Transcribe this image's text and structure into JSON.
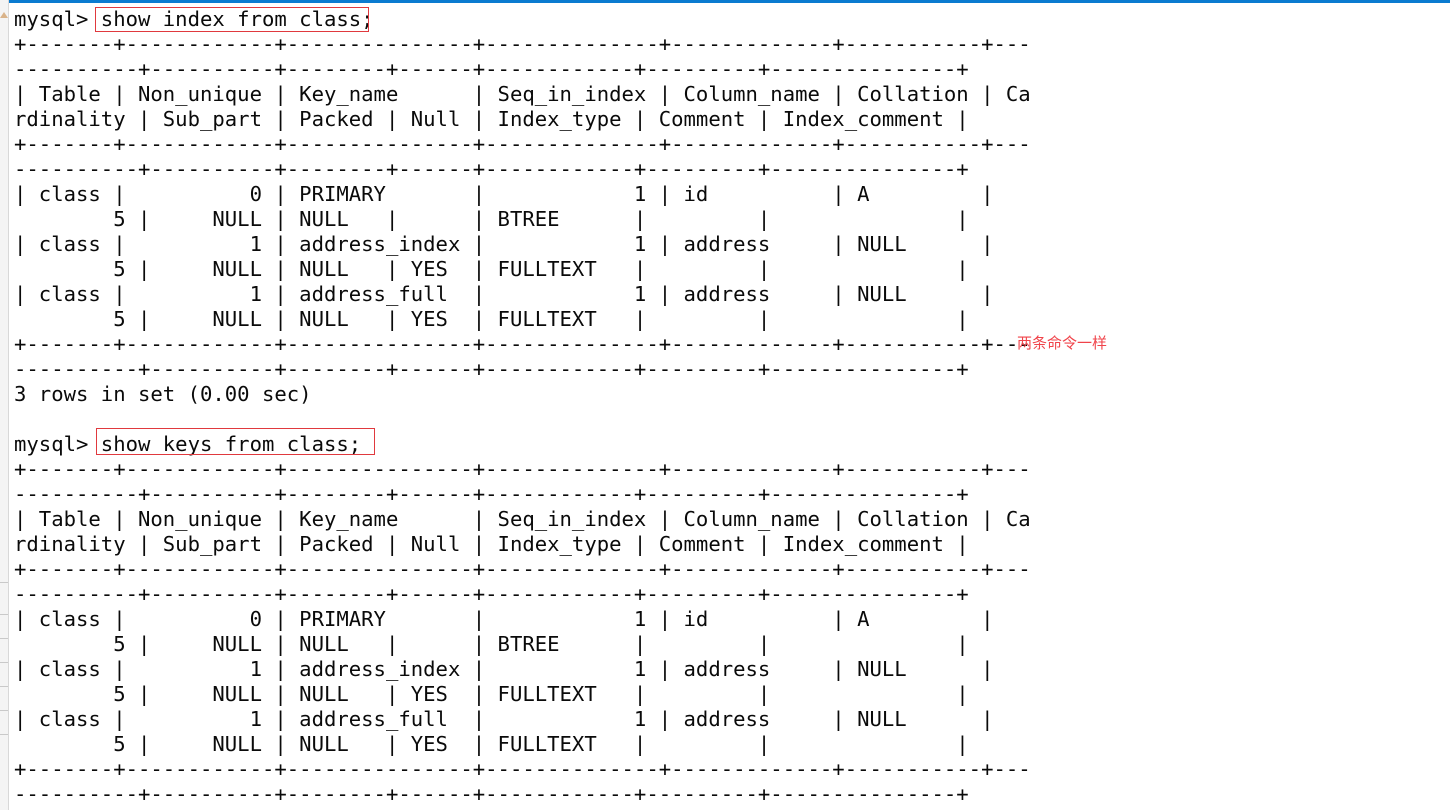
{
  "window": {
    "accent_color": "#0a7bd0",
    "highlight_color": "#e0393e",
    "annotation_color": "#f0434a"
  },
  "terminal": {
    "lines": [
      "mysql> show index from class;",
      "+-------+------------+---------------+--------------+-------------+-----------+---",
      "----------+----------+--------+------+------------+---------+---------------+",
      "| Table | Non_unique | Key_name      | Seq_in_index | Column_name | Collation | Ca",
      "rdinality | Sub_part | Packed | Null | Index_type | Comment | Index_comment |",
      "+-------+------------+---------------+--------------+-------------+-----------+---",
      "----------+----------+--------+------+------------+---------+---------------+",
      "| class |          0 | PRIMARY       |            1 | id          | A         |",
      "        5 |     NULL | NULL   |      | BTREE      |         |               |",
      "| class |          1 | address_index |            1 | address     | NULL      |",
      "        5 |     NULL | NULL   | YES  | FULLTEXT   |         |               |",
      "| class |          1 | address_full  |            1 | address     | NULL      |",
      "        5 |     NULL | NULL   | YES  | FULLTEXT   |         |               |",
      "+-------+------------+---------------+--------------+-------------+-----------+---",
      "----------+----------+--------+------+------------+---------+---------------+",
      "3 rows in set (0.00 sec)",
      "",
      "mysql> show keys from class;",
      "+-------+------------+---------------+--------------+-------------+-----------+---",
      "----------+----------+--------+------+------------+---------+---------------+",
      "| Table | Non_unique | Key_name      | Seq_in_index | Column_name | Collation | Ca",
      "rdinality | Sub_part | Packed | Null | Index_type | Comment | Index_comment |",
      "+-------+------------+---------------+--------------+-------------+-----------+---",
      "----------+----------+--------+------+------------+---------+---------------+",
      "| class |          0 | PRIMARY       |            1 | id          | A         |",
      "        5 |     NULL | NULL   |      | BTREE      |         |               |",
      "| class |          1 | address_index |            1 | address     | NULL      |",
      "        5 |     NULL | NULL   | YES  | FULLTEXT   |         |               |",
      "| class |          1 | address_full  |            1 | address     | NULL      |",
      "        5 |     NULL | NULL   | YES  | FULLTEXT   |         |               |",
      "+-------+------------+---------------+--------------+-------------+-----------+---",
      "----------+----------+--------+------+------------+---------+---------------+"
    ],
    "prompt": "mysql>",
    "commands": [
      "show index from class;",
      "show keys from class;"
    ],
    "result_summary": "3 rows in set (0.00 sec)",
    "columns": [
      "Table",
      "Non_unique",
      "Key_name",
      "Seq_in_index",
      "Column_name",
      "Collation",
      "Cardinality",
      "Sub_part",
      "Packed",
      "Null",
      "Index_type",
      "Comment",
      "Index_comment"
    ],
    "rows": [
      [
        "class",
        "0",
        "PRIMARY",
        "1",
        "id",
        "A",
        "5",
        "NULL",
        "NULL",
        "",
        "BTREE",
        "",
        ""
      ],
      [
        "class",
        "1",
        "address_index",
        "1",
        "address",
        "NULL",
        "5",
        "NULL",
        "NULL",
        "YES",
        "FULLTEXT",
        "",
        ""
      ],
      [
        "class",
        "1",
        "address_full",
        "1",
        "address",
        "NULL",
        "5",
        "NULL",
        "NULL",
        "YES",
        "FULLTEXT",
        "",
        ""
      ]
    ]
  },
  "annotation": {
    "text": "两条命令一样"
  }
}
